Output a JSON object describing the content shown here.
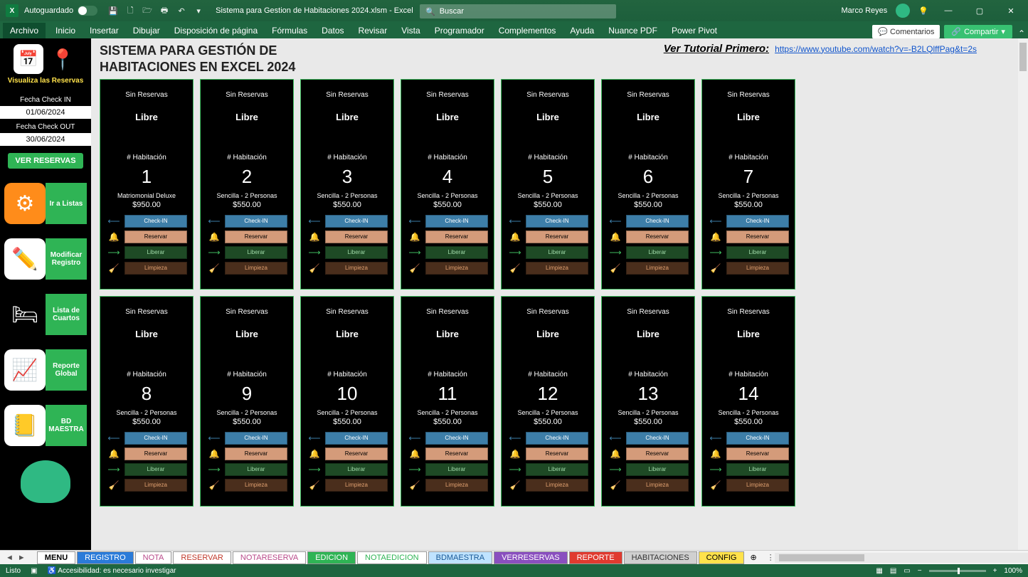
{
  "titlebar": {
    "autosave": "Autoguardado",
    "doc": "Sistema para Gestion de Habitaciones 2024.xlsm  -  Excel",
    "search_ph": "Buscar",
    "user": "Marco Reyes"
  },
  "ribbon": {
    "tabs": [
      "Archivo",
      "Inicio",
      "Insertar",
      "Dibujar",
      "Disposición de página",
      "Fórmulas",
      "Datos",
      "Revisar",
      "Vista",
      "Programador",
      "Complementos",
      "Ayuda",
      "Nuance PDF",
      "Power Pivot"
    ],
    "comments": "Comentarios",
    "share": "Compartir"
  },
  "leftpanel": {
    "viz": "Visualiza las Reservas",
    "checkin_lbl": "Fecha Check IN",
    "checkin_val": "01/06/2024",
    "checkout_lbl": "Fecha Check OUT",
    "checkout_val": "30/06/2024",
    "ver": "VER RESERVAS",
    "btns": [
      {
        "label": "Ir a Listas"
      },
      {
        "label": "Modificar Registro"
      },
      {
        "label": "Lista de Cuartos"
      },
      {
        "label": "Reporte Global"
      },
      {
        "label": "BD MAESTRA"
      }
    ]
  },
  "header": {
    "title": "SISTEMA PARA GESTIÓN DE HABITACIONES EN EXCEL 2024",
    "tut_lbl": "Ver Tutorial Primero:",
    "tut_url": "https://www.youtube.com/watch?v=-B2LQlffPag&t=2s"
  },
  "room_labels": {
    "sin": "Sin Reservas",
    "libre": "Libre",
    "hab": "# Habitación",
    "checkin": "Check-IN",
    "reservar": "Reservar",
    "liberar": "Liberar",
    "limpieza": "Limpieza"
  },
  "rooms": [
    {
      "num": "1",
      "type": "Matriomonial Deluxe",
      "price": "$950.00"
    },
    {
      "num": "2",
      "type": "Sencilla - 2 Personas",
      "price": "$550.00"
    },
    {
      "num": "3",
      "type": "Sencilla - 2 Personas",
      "price": "$550.00"
    },
    {
      "num": "4",
      "type": "Sencilla - 2 Personas",
      "price": "$550.00"
    },
    {
      "num": "5",
      "type": "Sencilla - 2 Personas",
      "price": "$550.00"
    },
    {
      "num": "6",
      "type": "Sencilla - 2 Personas",
      "price": "$550.00"
    },
    {
      "num": "7",
      "type": "Sencilla - 2 Personas",
      "price": "$550.00"
    },
    {
      "num": "8",
      "type": "Sencilla - 2 Personas",
      "price": "$550.00"
    },
    {
      "num": "9",
      "type": "Sencilla - 2 Personas",
      "price": "$550.00"
    },
    {
      "num": "10",
      "type": "Sencilla - 2 Personas",
      "price": "$550.00"
    },
    {
      "num": "11",
      "type": "Sencilla - 2 Personas",
      "price": "$550.00"
    },
    {
      "num": "12",
      "type": "Sencilla - 2 Personas",
      "price": "$550.00"
    },
    {
      "num": "13",
      "type": "Sencilla - 2 Personas",
      "price": "$550.00"
    },
    {
      "num": "14",
      "type": "Sencilla - 2 Personas",
      "price": "$550.00"
    }
  ],
  "sheets": [
    {
      "label": "MENU",
      "bg": "#ffffff",
      "fg": "#000",
      "bold": true
    },
    {
      "label": "REGISTRO",
      "bg": "#2b7bd9",
      "fg": "#fff"
    },
    {
      "label": "NOTA",
      "bg": "#ffffff",
      "fg": "#b94a8a"
    },
    {
      "label": "RESERVAR",
      "bg": "#ffffff",
      "fg": "#c0392b"
    },
    {
      "label": "NOTARESERVA",
      "bg": "#ffffff",
      "fg": "#b94a8a"
    },
    {
      "label": "EDICION",
      "bg": "#2fb455",
      "fg": "#fff"
    },
    {
      "label": "NOTAEDICION",
      "bg": "#ffffff",
      "fg": "#2fb455"
    },
    {
      "label": "BDMAESTRA",
      "bg": "#bfe3ff",
      "fg": "#1a5a96"
    },
    {
      "label": "VERRESERVAS",
      "bg": "#8a4fbf",
      "fg": "#fff"
    },
    {
      "label": "REPORTE",
      "bg": "#e03a2f",
      "fg": "#fff"
    },
    {
      "label": "HABITACIONES",
      "bg": "#d0d0d0",
      "fg": "#333"
    },
    {
      "label": "CONFIG",
      "bg": "#ffe24b",
      "fg": "#000"
    }
  ],
  "status": {
    "ready": "Listo",
    "access": "Accesibilidad: es necesario investigar",
    "zoom": "100%"
  }
}
